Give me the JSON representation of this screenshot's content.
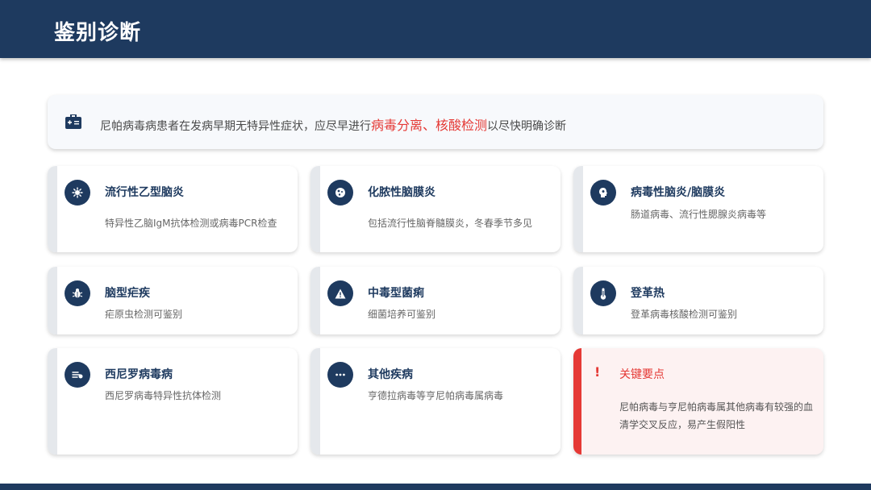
{
  "header": {
    "title": "鉴别诊断"
  },
  "note": {
    "text_before": "尼帕病毒病患者在发病早期无特异性症状，应尽早进行",
    "highlight": "病毒分离、核酸检测",
    "text_after": "以尽快明确诊断",
    "icon": "medical-kit-icon"
  },
  "cards": [
    {
      "title": "流行性乙型脑炎",
      "desc": "特异性乙脑IgM抗体检测或病毒PCR检查",
      "icon": "virus-icon"
    },
    {
      "title": "化脓性脑膜炎",
      "desc": "包括流行性脑脊髓膜炎，冬春季节多见",
      "icon": "bacteria-icon"
    },
    {
      "title": "病毒性脑炎/脑膜炎",
      "desc": "肠道病毒、流行性腮腺炎病毒等",
      "icon": "brain-icon"
    },
    {
      "title": "脑型疟疾",
      "desc": "疟原虫检测可鉴别",
      "icon": "bug-icon"
    },
    {
      "title": "中毒型菌痢",
      "desc": "细菌培养可鉴别",
      "icon": "warning-icon"
    },
    {
      "title": "登革热",
      "desc": "登革病毒核酸检测可鉴别",
      "icon": "thermometer-icon"
    },
    {
      "title": "西尼罗病毒病",
      "desc": "西尼罗病毒特异性抗体检测",
      "icon": "mosquito-icon"
    },
    {
      "title": "其他疾病",
      "desc": "亨德拉病毒等亨尼帕病毒属病毒",
      "icon": "ellipsis-icon"
    }
  ],
  "key_point": {
    "title": "关键要点",
    "icon": "exclamation-icon",
    "desc": "尼帕病毒与亨尼帕病毒属其他病毒有较强的血清学交叉反应，易产生假阳性"
  }
}
